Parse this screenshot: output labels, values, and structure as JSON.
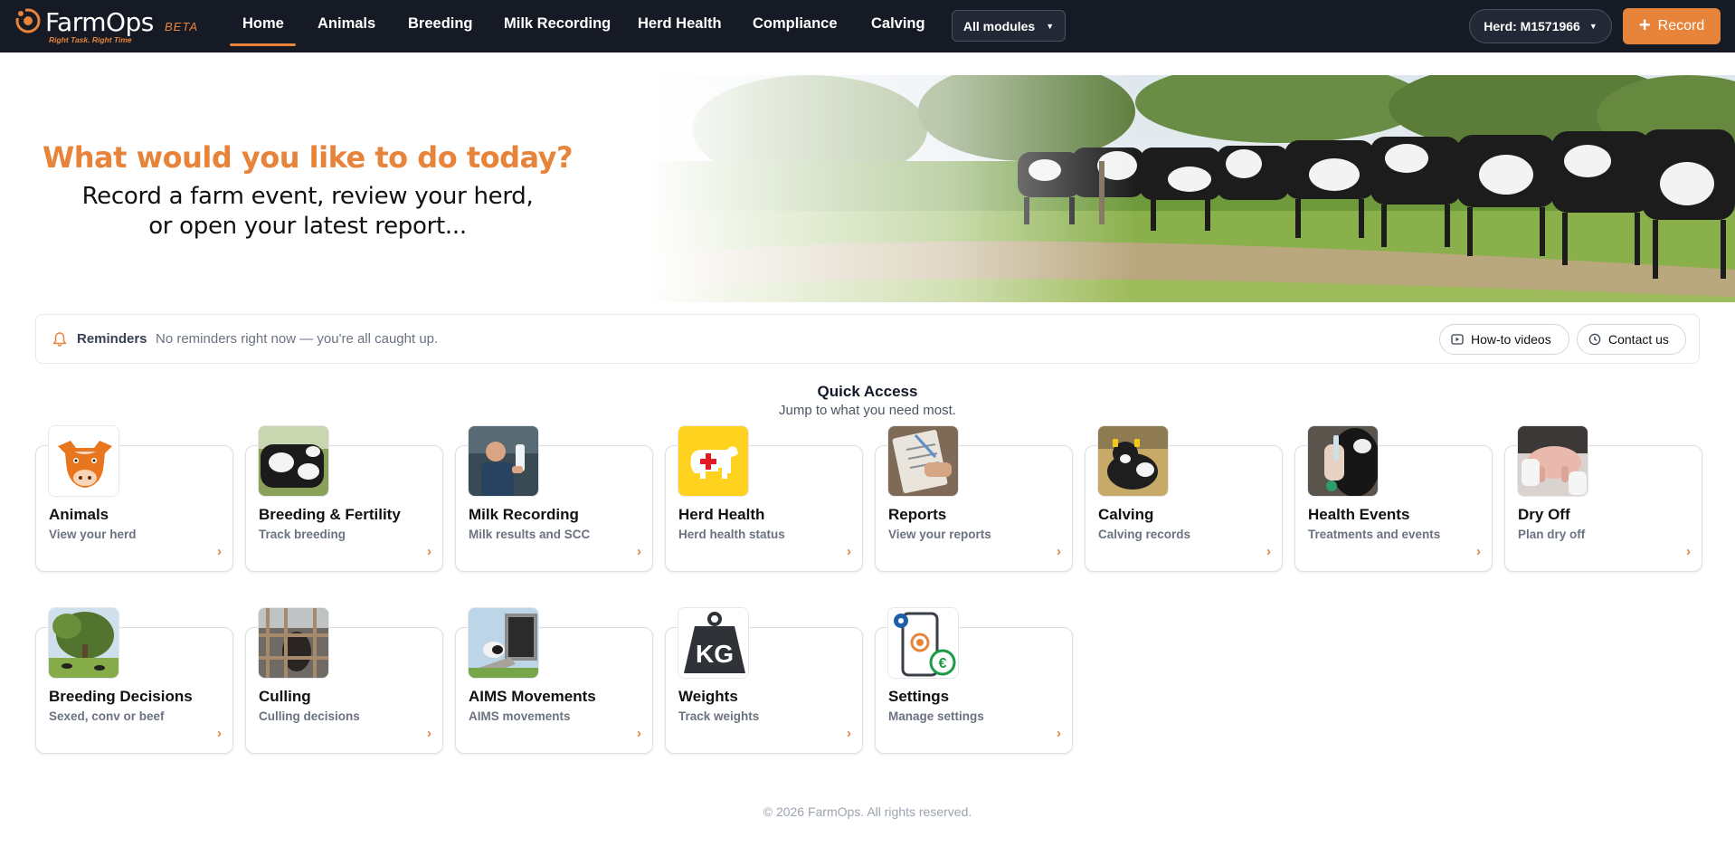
{
  "brand": {
    "name": "FarmOps",
    "beta": "BETA",
    "tagline": "Right Task. Right Time"
  },
  "nav": {
    "items": [
      {
        "label": "Home"
      },
      {
        "label": "Animals"
      },
      {
        "label": "Breeding"
      },
      {
        "label": "Milk Recording"
      },
      {
        "label": "Herd Health"
      },
      {
        "label": "Compliance"
      },
      {
        "label": "Calving"
      }
    ],
    "active": "Home",
    "modules_label": "All modules",
    "herd_label": "Herd: M1571966",
    "record_label": "Record"
  },
  "hero": {
    "title": "What would you like to do today?",
    "subtitle_line1": "Record a farm event, review your herd,",
    "subtitle_line2": "or open your latest report..."
  },
  "reminders": {
    "title": "Reminders",
    "text": "No reminders right now — you're all caught up.",
    "howto_label": "How-to videos",
    "contact_label": "Contact us"
  },
  "quick_access": {
    "title": "Quick Access",
    "subtitle": "Jump to what you need most.",
    "cards": [
      {
        "title": "Animals",
        "desc": "View your herd",
        "icon": "cow-head-icon"
      },
      {
        "title": "Breeding & Fertility",
        "desc": "Track breeding",
        "icon": "cows-photo"
      },
      {
        "title": "Milk Recording",
        "desc": "Milk results and SCC",
        "icon": "milk-sample-photo"
      },
      {
        "title": "Herd Health",
        "desc": "Herd health status",
        "icon": "health-cross-icon"
      },
      {
        "title": "Reports",
        "desc": "View your reports",
        "icon": "clipboard-photo"
      },
      {
        "title": "Calving",
        "desc": "Calving records",
        "icon": "calf-photo"
      },
      {
        "title": "Health Events",
        "desc": "Treatments and events",
        "icon": "treatment-photo"
      },
      {
        "title": "Dry Off",
        "desc": "Plan dry off",
        "icon": "udder-photo"
      },
      {
        "title": "Breeding Decisions",
        "desc": "Sexed, conv or beef",
        "icon": "pasture-photo"
      },
      {
        "title": "Culling",
        "desc": "Culling decisions",
        "icon": "pen-photo"
      },
      {
        "title": "AIMS Movements",
        "desc": "AIMS movements",
        "icon": "trailer-photo"
      },
      {
        "title": "Weights",
        "desc": "Track weights",
        "icon": "kg-weight-icon",
        "icon_text": "KG"
      },
      {
        "title": "Settings",
        "desc": "Manage settings",
        "icon": "settings-phone-icon"
      }
    ],
    "arrow": "›"
  },
  "footer": {
    "text": "© 2026 FarmOps. All rights reserved."
  },
  "colors": {
    "accent": "#e8833a",
    "navbar": "#161a24"
  }
}
